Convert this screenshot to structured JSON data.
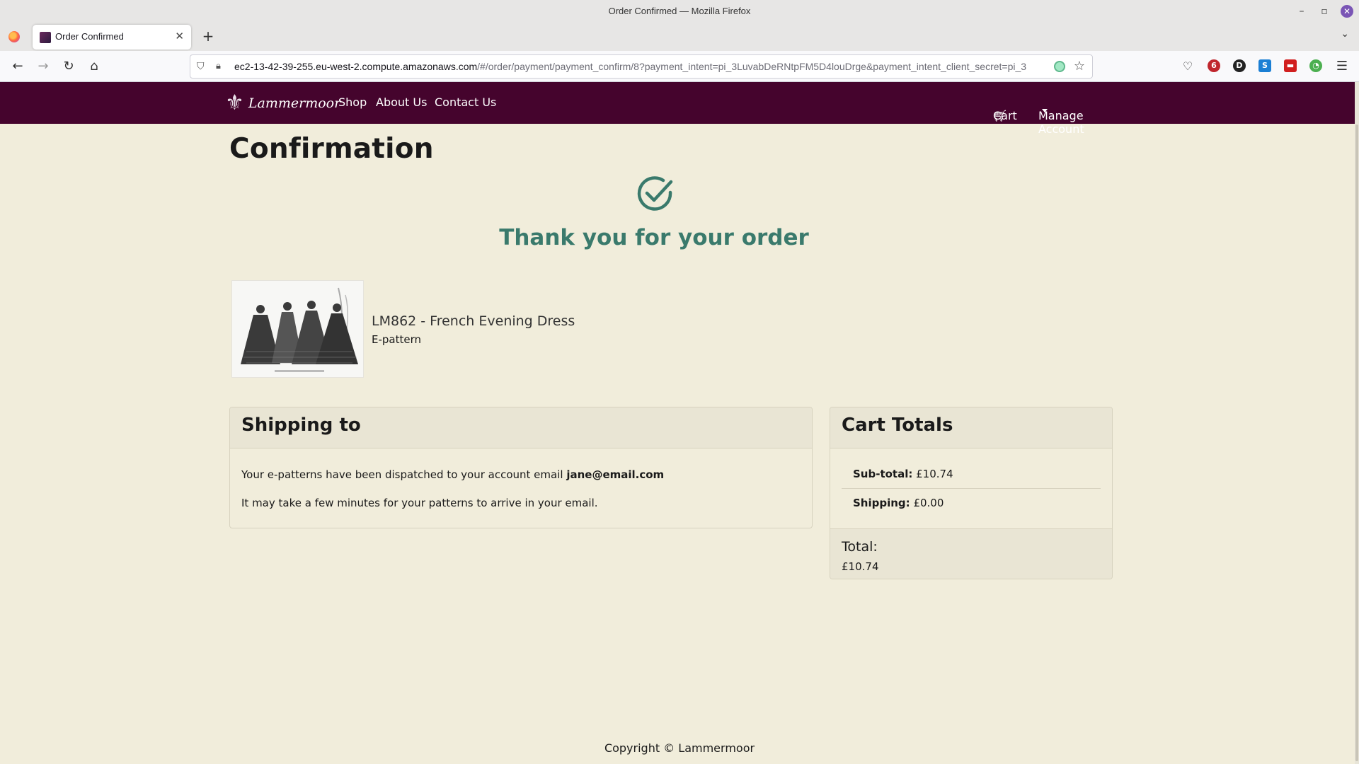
{
  "window": {
    "title": "Order Confirmed — Mozilla Firefox"
  },
  "browser": {
    "tab_title": "Order Confirmed",
    "url_host": "ec2-13-42-39-255.eu-west-2.compute.amazonaws.com",
    "url_path": "/#/order/payment/payment_confirm/8?payment_intent=pi_3LuvabDeRNtpFM5D4louDrge&payment_intent_client_secret=pi_3L",
    "extension_badge": "6"
  },
  "site": {
    "brand": "Lammermoor",
    "nav": {
      "shop": "Shop",
      "about": "About Us",
      "contact": "Contact Us",
      "cart": "Cart",
      "account": "Manage Account"
    }
  },
  "page": {
    "title": "Confirmation",
    "thanks": "Thank you for your order"
  },
  "product": {
    "name": "LM862 - French Evening Dress",
    "type": "E-pattern"
  },
  "shipping": {
    "heading": "Shipping to",
    "line1_prefix": "Your e-patterns have been dispatched to your account email",
    "email": "jane@email.com",
    "line2": "It may take a few minutes for your patterns to arrive in your email."
  },
  "totals": {
    "heading": "Cart Totals",
    "subtotal_label": "Sub-total:",
    "subtotal_value": "£10.74",
    "shipping_label": "Shipping:",
    "shipping_value": "£0.00",
    "total_label": "Total:",
    "total_value": "£10.74"
  },
  "footer": {
    "copyright": "Copyright © Lammermoor"
  },
  "colors": {
    "header_bg": "#45042d",
    "page_bg": "#f1eddb",
    "accent": "#3a7a6c"
  }
}
